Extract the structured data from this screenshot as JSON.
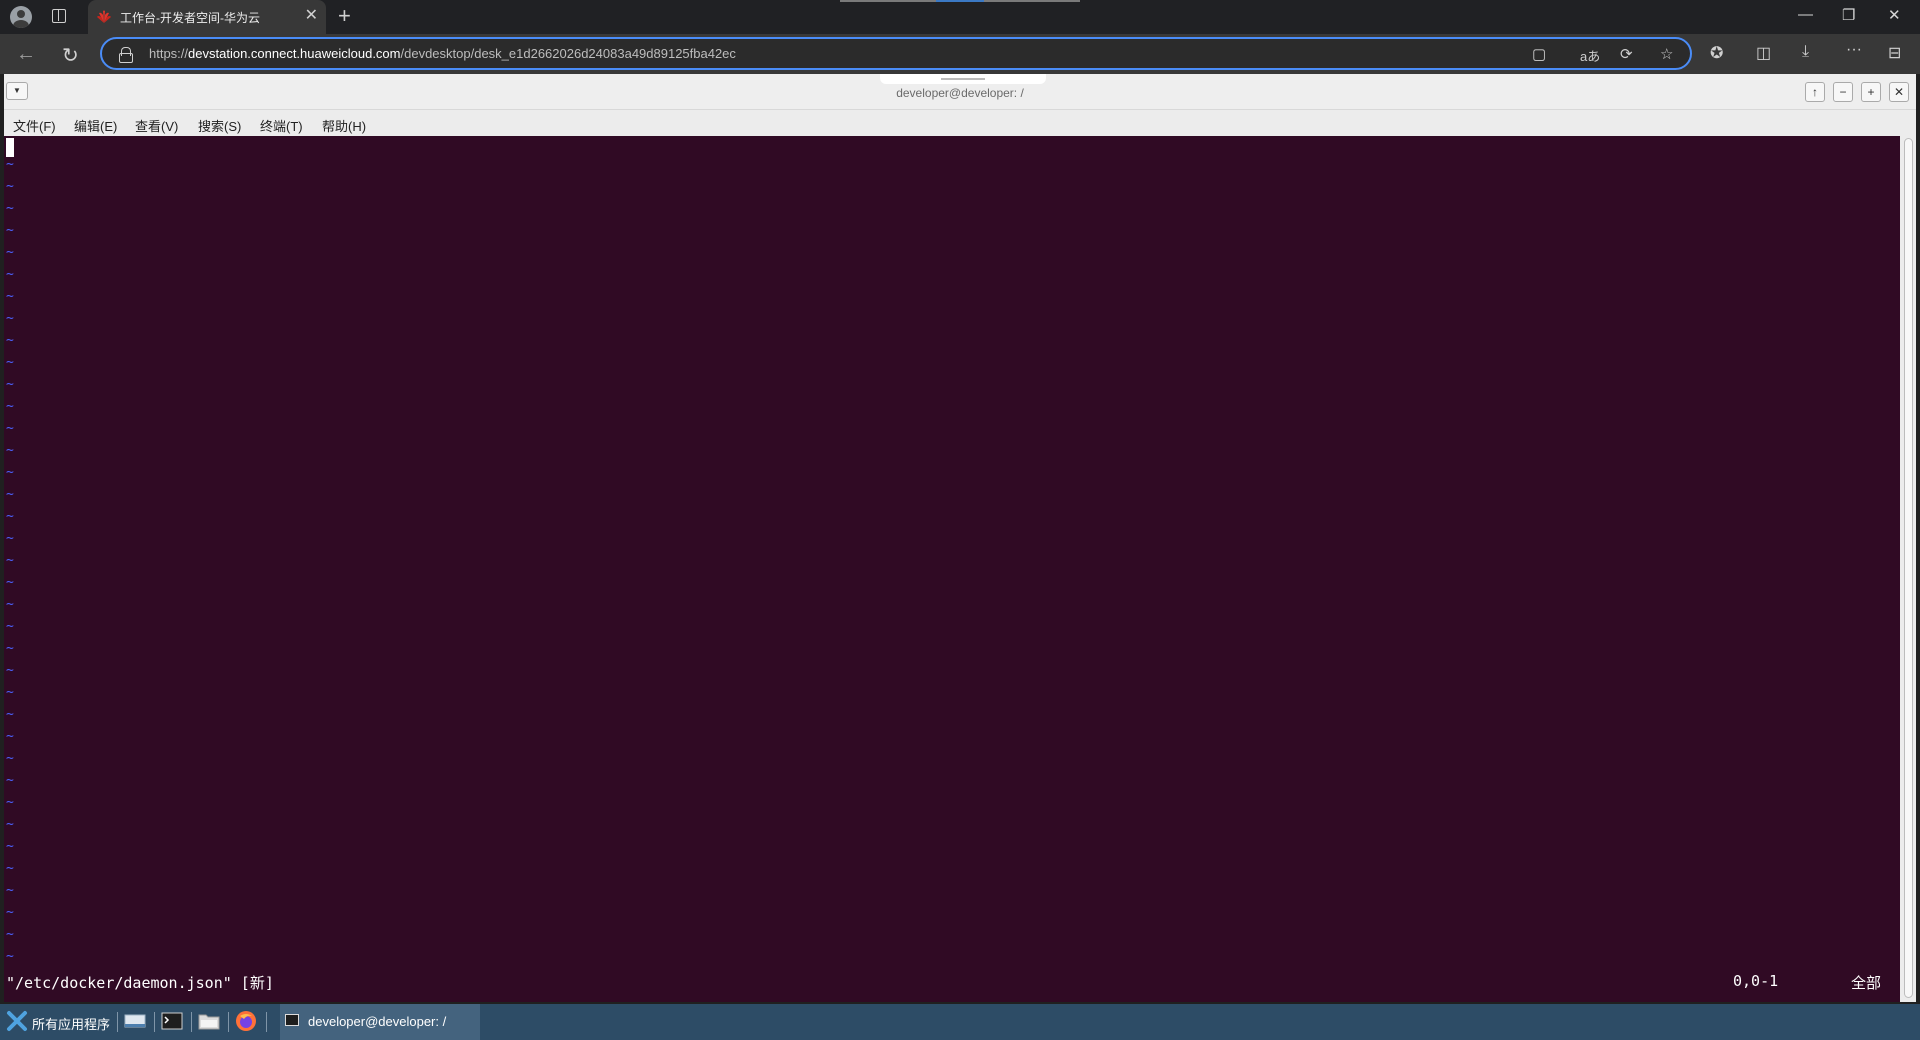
{
  "browser": {
    "tab": {
      "title": "工作台-开发者空间-华为云",
      "close": "✕"
    },
    "new_tab": "+",
    "window_controls": {
      "minimize": "—",
      "restore": "❐",
      "close": "✕"
    },
    "url": {
      "prefix": "https://",
      "host": "devstation.connect.huaweicloud.com",
      "path": "/devdesktop/desk_e1d2662026d24083a49d89125fba42ec"
    },
    "nav": {
      "back": "←",
      "reload": "↻"
    },
    "url_icons": {
      "tab_action": "▢",
      "translate": "aあ",
      "refresh_ext": "⟳",
      "favorite": "☆"
    },
    "toolbar_icons": {
      "extensions": "✪",
      "split": "◫",
      "download": "⤓",
      "more": "···",
      "sidebar": "⊟"
    }
  },
  "terminal": {
    "title": "developer@developer: /",
    "menu_toggle": "▼",
    "window_buttons": {
      "up": "↑",
      "minimize": "−",
      "maximize": "+",
      "close": "✕"
    },
    "menu": [
      "文件(F)",
      "编辑(E)",
      "查看(V)",
      "搜索(S)",
      "终端(T)",
      "帮助(H)"
    ],
    "vim": {
      "empty_line_marker": "~",
      "empty_lines": 37,
      "status_file": "\"/etc/docker/daemon.json\" [新]",
      "status_position": "0,0-1",
      "status_scroll": "全部"
    }
  },
  "taskbar": {
    "start_label": "所有应用程序",
    "launchers": [
      "desktop",
      "terminal",
      "files",
      "firefox"
    ],
    "task": {
      "label": "developer@developer: /"
    }
  },
  "colors": {
    "terminal_bg": "#300a24",
    "vim_tilde": "#4b62ff",
    "taskbar": "#2d4c66",
    "url_focus": "#4a8cf7"
  }
}
